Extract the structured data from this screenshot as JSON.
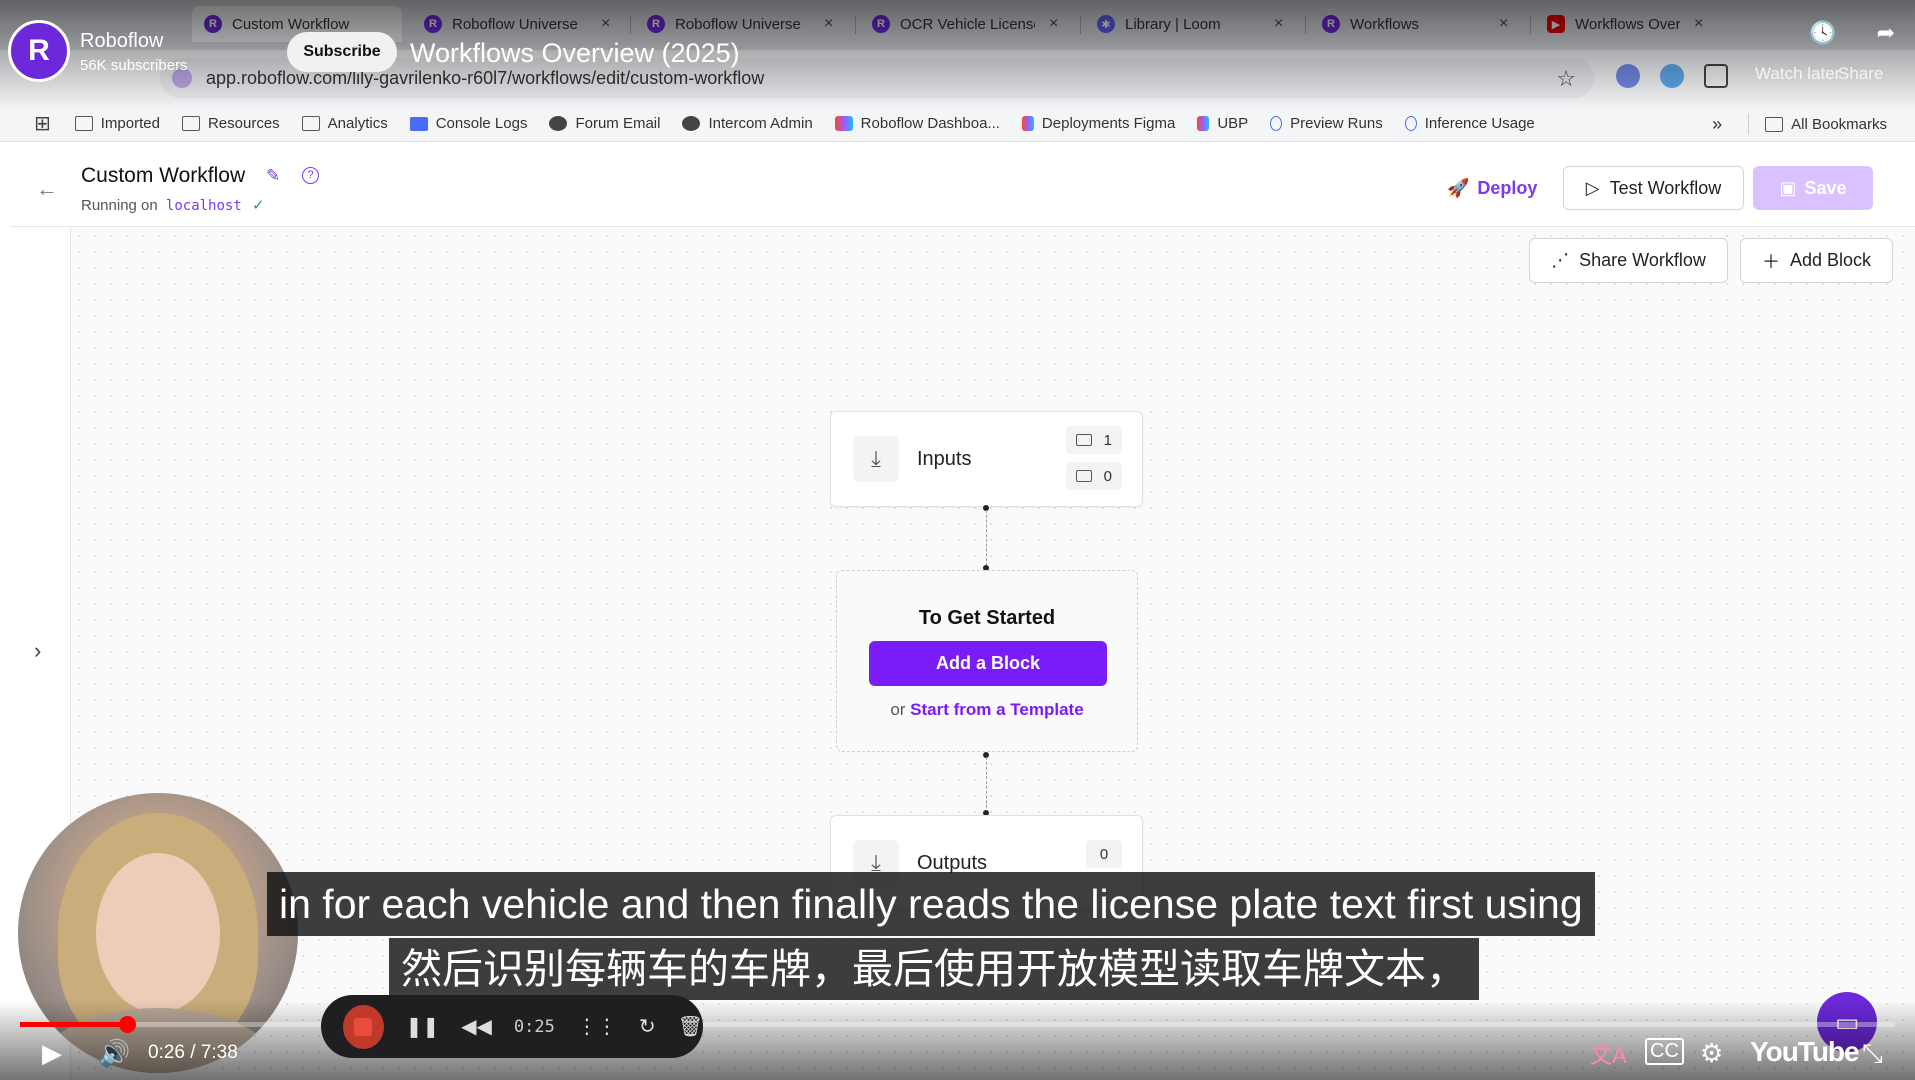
{
  "browser": {
    "tabs": [
      {
        "title": "Custom Workflow",
        "active": true
      },
      {
        "title": "Roboflow Universe"
      },
      {
        "title": "Roboflow Universe"
      },
      {
        "title": "OCR Vehicle License"
      },
      {
        "title": "Library | Loom"
      },
      {
        "title": "Workflows"
      },
      {
        "title": "Workflows Overview"
      }
    ],
    "url": "app.roboflow.com/lily-gavrilenko-r60l7/workflows/edit/custom-workflow",
    "bookmarks": [
      {
        "label": "Imported",
        "icon": "folder-icon"
      },
      {
        "label": "Resources",
        "icon": "folder-icon"
      },
      {
        "label": "Analytics",
        "icon": "folder-icon"
      },
      {
        "label": "Console Logs",
        "icon": "list-icon"
      },
      {
        "label": "Forum Email",
        "icon": "globe-icon"
      },
      {
        "label": "Intercom Admin",
        "icon": "globe-icon"
      },
      {
        "label": "Roboflow Dashboa...",
        "icon": "roboflow-icon"
      },
      {
        "label": "Deployments Figma",
        "icon": "figma-icon"
      },
      {
        "label": "UBP",
        "icon": "figma-icon"
      },
      {
        "label": "Preview Runs",
        "icon": "person-icon"
      },
      {
        "label": "Inference Usage",
        "icon": "person-icon"
      }
    ],
    "all_bookmarks": "All Bookmarks",
    "more": "»"
  },
  "app": {
    "workflow_title": "Custom Workflow",
    "running_label": "Running on",
    "host": "localhost",
    "deploy_label": "Deploy",
    "test_label": "Test Workflow",
    "save_label": "Save",
    "share_label": "Share Workflow",
    "add_block_label": "Add Block"
  },
  "canvas": {
    "inputs": {
      "label": "Inputs",
      "image_count": "1",
      "param_count": "0"
    },
    "start": {
      "title": "To Get Started",
      "button": "Add a Block",
      "or": "or",
      "template_link": "Start from a Template"
    },
    "outputs": {
      "label": "Outputs",
      "count": "0"
    }
  },
  "youtube": {
    "channel": "Roboflow",
    "subscribers": "56K subscribers",
    "subscribe": "Subscribe",
    "video_title": "Workflows Overview (2025)",
    "watch_later": "Watch later",
    "share": "Share",
    "time": "0:26 / 7:38",
    "progress": 0.057,
    "caption_en": "in for each vehicle and then finally reads the license plate text first using",
    "caption_zh": "然后识别每辆车的车牌，最后使用开放模型读取车牌文本，",
    "logo": "YouTube",
    "recorder_time": "0:25"
  }
}
